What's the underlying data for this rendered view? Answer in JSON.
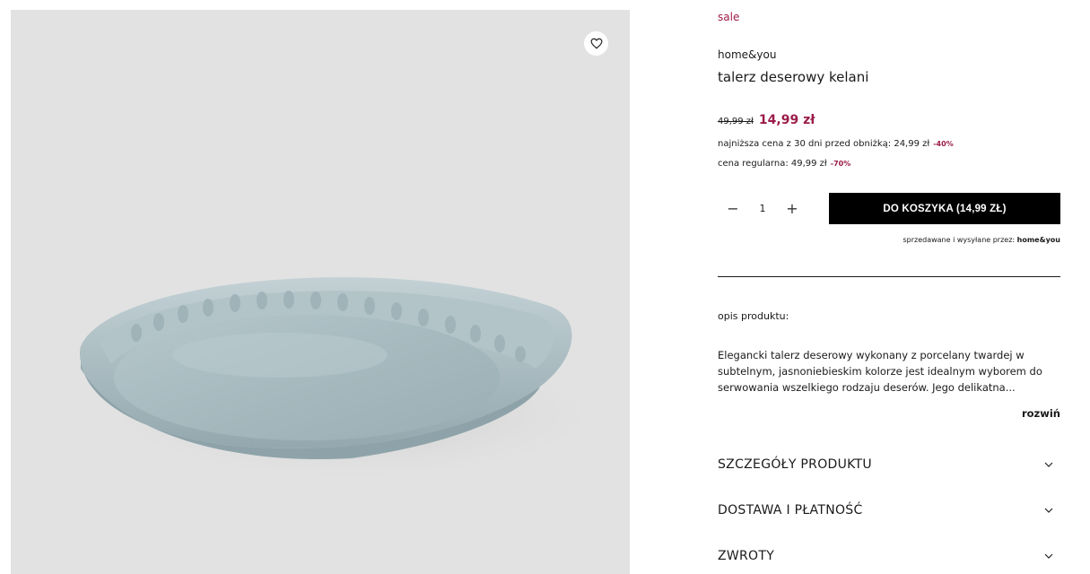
{
  "sale_tag": "sale",
  "brand": "home&you",
  "product_name": "talerz deserowy kelani",
  "price": {
    "old": "49,99 zł",
    "new": "14,99 zł",
    "lowest_label": "najniższa cena z 30 dni przed obniżką: 24,99 zł",
    "lowest_discount": "-40%",
    "regular_label": "cena regularna: 49,99 zł",
    "regular_discount": "-70%"
  },
  "quantity": {
    "minus": "−",
    "value": "1",
    "plus": "+"
  },
  "cart_button": "DO KOSZYKA  (14,99 ZŁ)",
  "seller": {
    "prefix": "sprzedawane i wysyłane przez:",
    "name": "home&you"
  },
  "description": {
    "heading": "opis produktu:",
    "text": "Elegancki talerz deserowy wykonany z porcelany twardej w subtelnym, jasnoniebieskim kolorze jest idealnym wyborem do serwowania wszelkiego rodzaju deserów. Jego delikatna...",
    "expand": "rozwiń"
  },
  "accordion": [
    {
      "label": "SZCZEGÓŁY PRODUKTU"
    },
    {
      "label": "DOSTAWA I PŁATNOŚĆ"
    },
    {
      "label": "ZWROTY"
    }
  ],
  "icons": {
    "favorite": "heart-icon",
    "chevron": "chevron-down-icon"
  },
  "colors": {
    "accent": "#9b1c4a",
    "button_bg": "#000000",
    "image_bg": "#e2e2e2",
    "plate": "#a9bcc1"
  }
}
